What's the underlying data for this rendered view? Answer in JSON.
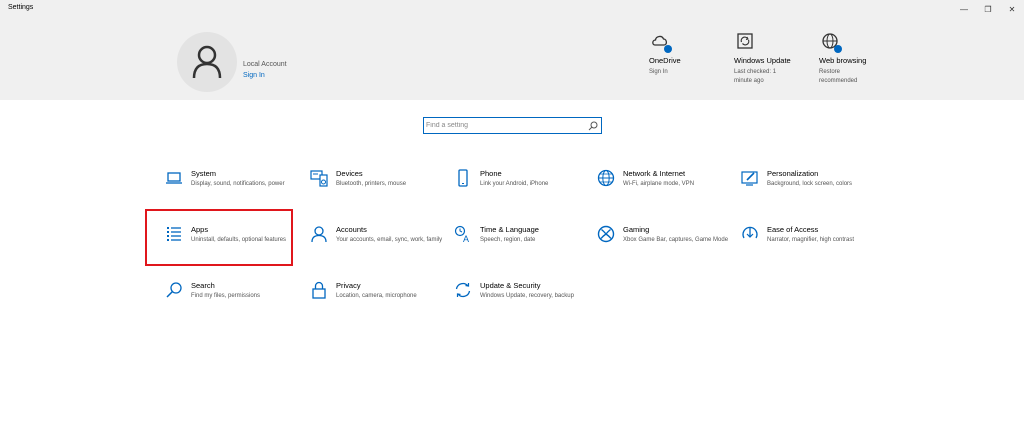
{
  "window": {
    "title": "Settings",
    "min": "—",
    "restore": "❐",
    "close": "✕"
  },
  "account": {
    "name": "Local Account",
    "signin": "Sign In"
  },
  "header_items": [
    {
      "title": "OneDrive",
      "sub": "Sign In"
    },
    {
      "title": "Windows Update",
      "sub": "Last checked: 1 minute ago"
    },
    {
      "title": "Web browsing",
      "sub": "Restore recommended"
    }
  ],
  "search": {
    "placeholder": "Find a setting"
  },
  "tiles": [
    {
      "title": "System",
      "desc": "Display, sound, notifications, power"
    },
    {
      "title": "Devices",
      "desc": "Bluetooth, printers, mouse"
    },
    {
      "title": "Phone",
      "desc": "Link your Android, iPhone"
    },
    {
      "title": "Network & Internet",
      "desc": "Wi-Fi, airplane mode, VPN"
    },
    {
      "title": "Personalization",
      "desc": "Background, lock screen, colors"
    },
    {
      "title": "Apps",
      "desc": "Uninstall, defaults, optional features"
    },
    {
      "title": "Accounts",
      "desc": "Your accounts, email, sync, work, family"
    },
    {
      "title": "Time & Language",
      "desc": "Speech, region, date"
    },
    {
      "title": "Gaming",
      "desc": "Xbox Game Bar, captures, Game Mode"
    },
    {
      "title": "Ease of Access",
      "desc": "Narrator, magnifier, high contrast"
    },
    {
      "title": "Search",
      "desc": "Find my files, permissions"
    },
    {
      "title": "Privacy",
      "desc": "Location, camera, microphone"
    },
    {
      "title": "Update & Security",
      "desc": "Windows Update, recovery, backup"
    }
  ],
  "colors": {
    "accent": "#0067c0",
    "highlight": "#e0161c",
    "header_bg": "#f0f0f0"
  }
}
